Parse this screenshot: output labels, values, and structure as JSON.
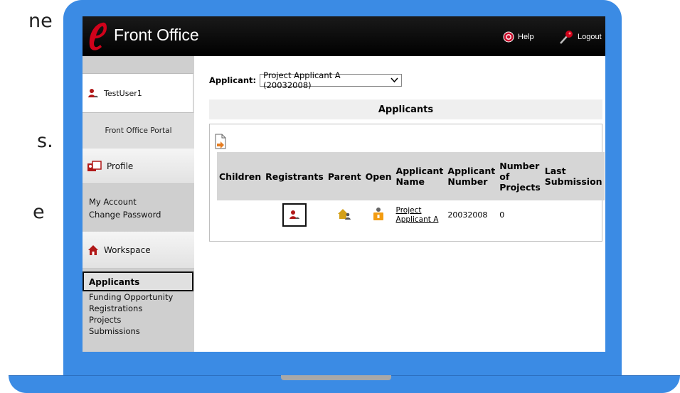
{
  "slide": {
    "fragments": [
      "ne",
      "s.",
      "e"
    ]
  },
  "header": {
    "app_title": "Front Office",
    "help_label": "Help",
    "logout_label": "Logout"
  },
  "sidebar": {
    "user_name": "TestUser1",
    "portal_label": "Front Office Portal",
    "profile": {
      "title": "Profile",
      "links": [
        "My Account",
        "Change Password"
      ]
    },
    "workspace": {
      "title": "Workspace",
      "active_item": "Applicants",
      "items": [
        "Funding Opportunity Registrations",
        "Projects",
        "Submissions"
      ]
    }
  },
  "main": {
    "applicant_label": "Applicant:",
    "applicant_selected": "Project Applicant A (20032008)",
    "panel_title": "Applicants",
    "table": {
      "columns": [
        "Children",
        "Registrants",
        "Parent",
        "Open",
        "Applicant Name",
        "Applicant Number",
        "Number of Projects",
        "Last Submission"
      ],
      "rows": [
        {
          "applicant_name": "Project Applicant A",
          "applicant_number": "20032008",
          "number_of_projects": "0",
          "last_submission": ""
        }
      ]
    }
  },
  "colors": {
    "laptop_frame": "#3b8be4",
    "header_bar": "#000000",
    "sidebar_bg": "#cfcfcf",
    "table_header_bg": "#d6d6d6",
    "logo_red": "#d0021b"
  },
  "icons": {
    "logo": "e-logo-icon",
    "help": "help-icon",
    "logout": "logout-key-icon",
    "user": "user-icon",
    "profile": "profile-cards-icon",
    "workspace": "house-icon",
    "export": "export-document-icon",
    "registrants": "registrants-user-icon",
    "parent": "parent-house-icon",
    "open": "open-lock-icon"
  }
}
